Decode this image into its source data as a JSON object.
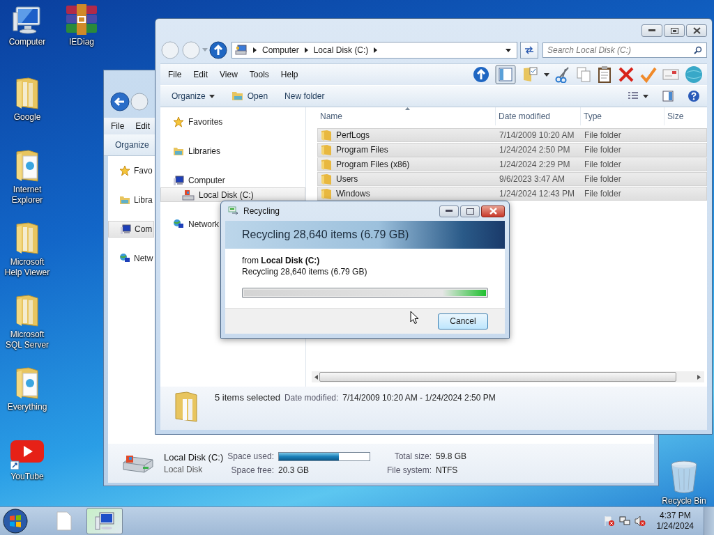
{
  "desktop_icons": [
    {
      "label": "Computer",
      "kind": "computer"
    },
    {
      "label": "Google",
      "kind": "folder"
    },
    {
      "label": "Internet Explorer",
      "kind": "folder-doc"
    },
    {
      "label": "Microsoft Help Viewer",
      "kind": "folder"
    },
    {
      "label": "Microsoft SQL Server",
      "kind": "folder"
    },
    {
      "label": "Everything",
      "kind": "folder-doc"
    },
    {
      "label": "YouTube",
      "kind": "video"
    },
    {
      "label": "IEDiag",
      "kind": "archive"
    }
  ],
  "recycle_bin": {
    "label": "Recycle Bin"
  },
  "back_window": {
    "menu": [
      "File",
      "Edit"
    ],
    "command": "Organize",
    "nav": [
      {
        "label": "Favo",
        "kind": "favorites",
        "selected": false
      },
      {
        "label": "Libra",
        "kind": "libraries",
        "selected": false
      },
      {
        "label": "Com",
        "kind": "computer",
        "selected": true
      },
      {
        "label": "Netw",
        "kind": "network",
        "selected": false
      }
    ],
    "details": {
      "title": "Local Disk (C:)",
      "subtitle": "Local Disk",
      "fields": [
        {
          "label": "Space used:",
          "kind": "bar",
          "level": 0.66
        },
        {
          "label": "Total size:",
          "kind": "text",
          "value": "59.8 GB"
        },
        {
          "label": "Space free:",
          "kind": "text",
          "value": "20.3 GB"
        },
        {
          "label": "File system:",
          "kind": "text",
          "value": "NTFS"
        }
      ]
    }
  },
  "main_window": {
    "address": {
      "crumbs": [
        "Computer",
        "Local Disk (C:)"
      ]
    },
    "search": {
      "placeholder": "Search Local Disk (C:)"
    },
    "menu": [
      "File",
      "Edit",
      "View",
      "Tools",
      "Help"
    ],
    "commands": [
      {
        "label": "Organize",
        "kind": "dropdown"
      },
      {
        "label": "Open",
        "kind": "open"
      },
      {
        "label": "New folder",
        "kind": "plain"
      }
    ],
    "nav": [
      {
        "label": "Favorites",
        "kind": "favorites",
        "selected": false
      },
      {
        "label": "Libraries",
        "kind": "libraries",
        "selected": false
      },
      {
        "label": "Computer",
        "kind": "computer",
        "selected": false,
        "children": [
          {
            "label": "Local Disk (C:)",
            "kind": "drive",
            "selected": true
          }
        ]
      },
      {
        "label": "Network",
        "kind": "network",
        "selected": false
      }
    ],
    "table": {
      "columns": [
        {
          "label": "Name",
          "sorted": true
        },
        {
          "label": "Date modified",
          "sorted": false
        },
        {
          "label": "Type",
          "sorted": false
        },
        {
          "label": "Size",
          "sorted": false
        }
      ],
      "rows": [
        {
          "name": "PerfLogs",
          "date": "7/14/2009 10:20 AM",
          "type": "File folder",
          "selected": true
        },
        {
          "name": "Program Files",
          "date": "1/24/2024 2:50 PM",
          "type": "File folder",
          "selected": true
        },
        {
          "name": "Program Files (x86)",
          "date": "1/24/2024 2:29 PM",
          "type": "File folder",
          "selected": true
        },
        {
          "name": "Users",
          "date": "9/6/2023 3:47 AM",
          "type": "File folder",
          "selected": true
        },
        {
          "name": "Windows",
          "date": "1/24/2024 12:43 PM",
          "type": "File folder",
          "selected": true
        }
      ]
    },
    "details": {
      "summary": "5 items selected",
      "label": "Date modified:",
      "value": "7/14/2009 10:20 AM - 1/24/2024 2:50 PM"
    }
  },
  "dialog": {
    "title": "Recycling",
    "heading": "Recycling 28,640 items (6.79 GB)",
    "source": "from **Local Disk (C:)**",
    "status": "Recycling 28,640 items (6.79 GB)",
    "progress": {
      "level": 1
    },
    "buttons": [
      "Cancel"
    ]
  },
  "taskbar": {
    "buttons": [
      {
        "kind": "file",
        "selected": false
      },
      {
        "kind": "explorer",
        "selected": true
      }
    ],
    "time": "4:37 PM",
    "date": "1/24/2024"
  }
}
